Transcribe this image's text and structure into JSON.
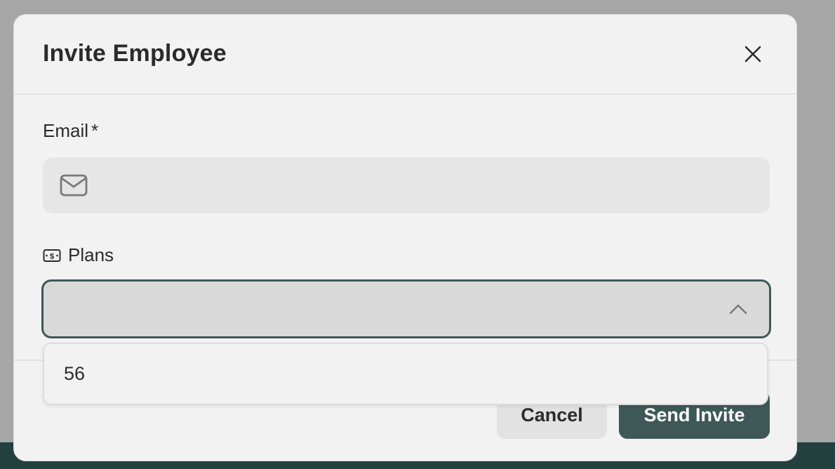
{
  "dialog": {
    "title": "Invite Employee",
    "close_icon": "close-icon"
  },
  "email": {
    "label": "Email",
    "required_marker": "*",
    "icon": "mail-icon",
    "value": "",
    "placeholder": ""
  },
  "plans": {
    "label": "Plans",
    "icon": "money-icon",
    "selected_value": "",
    "state": "open",
    "chevron_icon": "chevron-up-icon",
    "options": [
      "56"
    ]
  },
  "footer": {
    "cancel_label": "Cancel",
    "submit_label": "Send Invite"
  },
  "colors": {
    "accent": "#3e5858",
    "overlay": "#a6a6a6",
    "modal_bg": "#f2f2f2",
    "input_bg": "#e6e6e6",
    "page_bar": "#22403e"
  }
}
